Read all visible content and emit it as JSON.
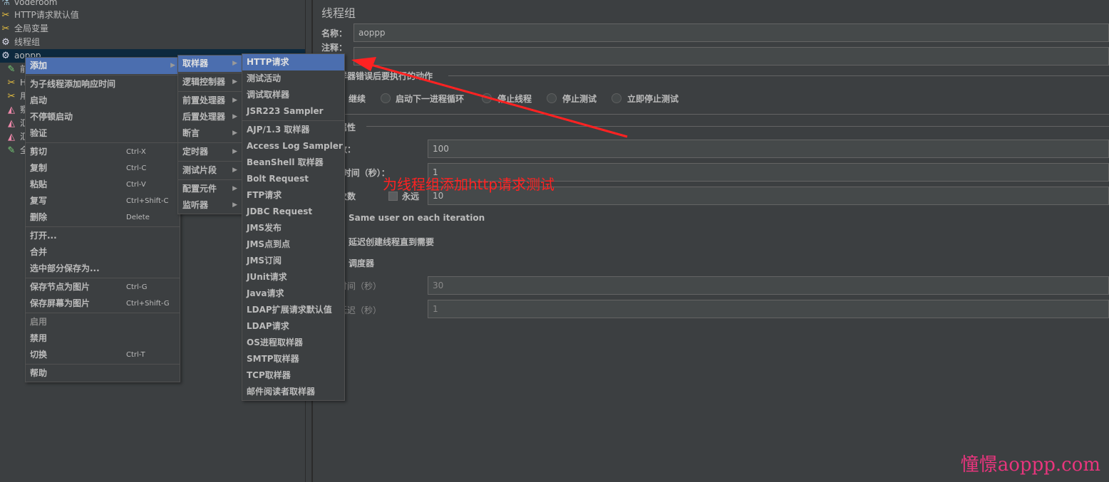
{
  "tree": {
    "items": [
      {
        "label": "voderoom",
        "icon": "flask-icon"
      },
      {
        "label": "HTTP请求默认值",
        "icon": "wrench-icon"
      },
      {
        "label": "全局变量",
        "icon": "wrench-icon"
      },
      {
        "label": "线程组",
        "icon": "gear-icon"
      },
      {
        "label": "aoppp",
        "icon": "gear-icon",
        "selected": true
      },
      {
        "label": "前",
        "icon": "pipette-icon"
      },
      {
        "label": "H",
        "icon": "wrench-icon"
      },
      {
        "label": "用",
        "icon": "wrench-icon"
      },
      {
        "label": "察",
        "icon": "graph-icon"
      },
      {
        "label": "汇",
        "icon": "graph-icon"
      },
      {
        "label": "汇",
        "icon": "graph-icon"
      },
      {
        "label": "全",
        "icon": "pipette-icon"
      }
    ]
  },
  "panel": {
    "title": "线程组",
    "name_label": "名称：",
    "name_value": "aoppp",
    "comment_label": "注释：",
    "comment_value": "",
    "error_action_title": "在取样器错误后要执行的动作",
    "error_actions": [
      "继续",
      "启动下一进程循环",
      "停止线程",
      "停止测试",
      "立即停止测试"
    ],
    "thread_props_title": "线程属性",
    "threads_label": "线程数：",
    "threads_value": "100",
    "rampup_label": "Ramp-Up时间（秒）：",
    "rampup_value": "1",
    "loop_label": "循环次数",
    "forever_label": "永远",
    "loop_value": "10",
    "same_user_label": "Same user on each iteration",
    "delay_create_label": "延迟创建线程直到需要",
    "scheduler_label": "调度器",
    "duration_label": "持续时间（秒）",
    "duration_value": "30",
    "startup_delay_label": "启动延迟（秒）",
    "startup_delay_value": "1"
  },
  "context_menu": {
    "items": [
      {
        "label": "添加",
        "submenu": true,
        "highlighted": true
      },
      {
        "sep": true
      },
      {
        "label": "为子线程添加响应时间"
      },
      {
        "label": "启动"
      },
      {
        "label": "不停顿启动"
      },
      {
        "label": "验证"
      },
      {
        "sep": true
      },
      {
        "label": "剪切",
        "shortcut": "Ctrl-X"
      },
      {
        "label": "复制",
        "shortcut": "Ctrl-C"
      },
      {
        "label": "粘贴",
        "shortcut": "Ctrl-V"
      },
      {
        "label": "复写",
        "shortcut": "Ctrl+Shift-C"
      },
      {
        "label": "删除",
        "shortcut": "Delete"
      },
      {
        "sep": true
      },
      {
        "label": "打开..."
      },
      {
        "label": "合并"
      },
      {
        "label": "选中部分保存为..."
      },
      {
        "sep": true
      },
      {
        "label": "保存节点为图片",
        "shortcut": "Ctrl-G"
      },
      {
        "label": "保存屏幕为图片",
        "shortcut": "Ctrl+Shift-G"
      },
      {
        "sep": true
      },
      {
        "label": "启用",
        "disabled": true
      },
      {
        "label": "禁用"
      },
      {
        "label": "切换",
        "shortcut": "Ctrl-T"
      },
      {
        "sep": true
      },
      {
        "label": "帮助"
      }
    ]
  },
  "add_menu": {
    "items": [
      {
        "label": "取样器",
        "submenu": true,
        "highlighted": true
      },
      {
        "sep": true
      },
      {
        "label": "逻辑控制器",
        "submenu": true
      },
      {
        "sep": true
      },
      {
        "label": "前置处理器",
        "submenu": true
      },
      {
        "label": "后置处理器",
        "submenu": true
      },
      {
        "label": "断言",
        "submenu": true
      },
      {
        "sep": true
      },
      {
        "label": "定时器",
        "submenu": true
      },
      {
        "sep": true
      },
      {
        "label": "测试片段",
        "submenu": true
      },
      {
        "sep": true
      },
      {
        "label": "配置元件",
        "submenu": true
      },
      {
        "label": "监听器",
        "submenu": true
      }
    ]
  },
  "sampler_menu": {
    "items": [
      {
        "label": "HTTP请求",
        "highlighted": true
      },
      {
        "label": "测试活动"
      },
      {
        "label": "调试取样器"
      },
      {
        "label": "JSR223 Sampler"
      },
      {
        "sep": true
      },
      {
        "label": "AJP/1.3 取样器"
      },
      {
        "label": "Access Log Sampler"
      },
      {
        "label": "BeanShell 取样器"
      },
      {
        "label": "Bolt Request"
      },
      {
        "label": "FTP请求"
      },
      {
        "label": "JDBC Request"
      },
      {
        "label": "JMS发布"
      },
      {
        "label": "JMS点到点"
      },
      {
        "label": "JMS订阅"
      },
      {
        "label": "JUnit请求"
      },
      {
        "label": "Java请求"
      },
      {
        "label": "LDAP扩展请求默认值"
      },
      {
        "label": "LDAP请求"
      },
      {
        "label": "OS进程取样器"
      },
      {
        "label": "SMTP取样器"
      },
      {
        "label": "TCP取样器"
      },
      {
        "label": "邮件阅读者取样器"
      }
    ]
  },
  "annotation": {
    "text": "为线程组添加http请求测试",
    "color": "#ff2222"
  },
  "watermark": "憧憬aoppp.com",
  "colors": {
    "background": "#3c3f41",
    "highlight": "#4b6eaf",
    "selection": "#0d293e",
    "arrow": "#ff2222"
  }
}
